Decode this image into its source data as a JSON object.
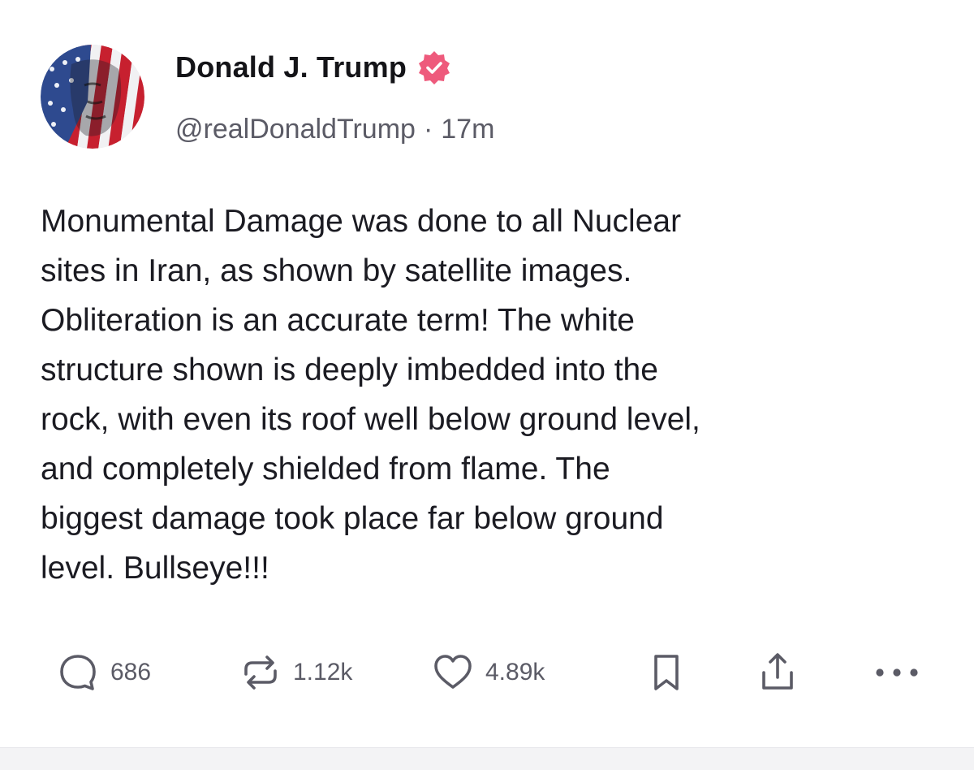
{
  "post": {
    "author": {
      "display_name": "Donald J. Trump",
      "handle": "@realDonaldTrump",
      "verified": true,
      "avatar_icon": "flag-portrait-avatar"
    },
    "timestamp": "17m",
    "separator": "·",
    "text": "Monumental Damage was done to all Nuclear\nsites in Iran, as shown by satellite images.\nObliteration is an accurate term! The white\nstructure shown is deeply imbedded into the\nrock, with even its roof well below ground level,\nand completely shielded from flame. The\nbiggest damage took place far below ground\nlevel. Bullseye!!!",
    "actions": {
      "replies": "686",
      "reposts": "1.12k",
      "likes": "4.89k"
    }
  },
  "colors": {
    "verified_badge": "#ee5a7c",
    "icon_gray": "#5b5b66",
    "text": "#1b1b22"
  }
}
